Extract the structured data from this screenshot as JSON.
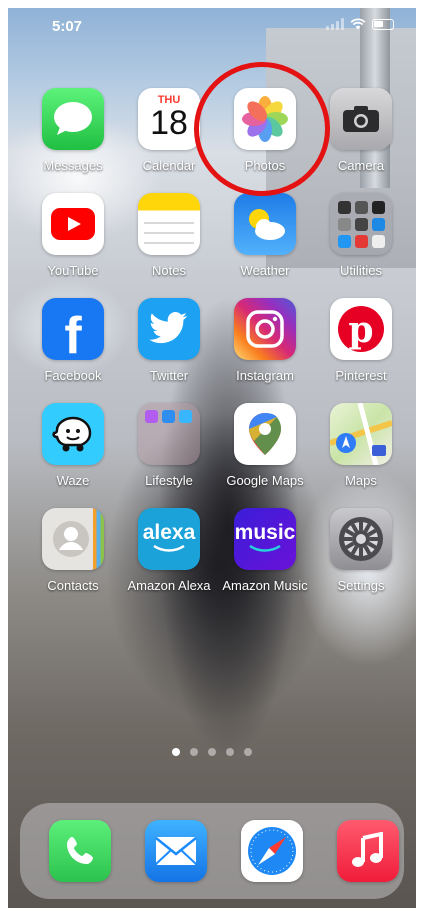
{
  "status_bar": {
    "time": "5:07"
  },
  "apps": [
    {
      "label": "Messages",
      "icon": "messages-icon",
      "color": "#2fd158"
    },
    {
      "label": "Calendar",
      "icon": "calendar-icon",
      "day": "THU",
      "date": "18"
    },
    {
      "label": "Photos",
      "icon": "photos-icon"
    },
    {
      "label": "Camera",
      "icon": "camera-icon",
      "color": "#3a3a3c"
    },
    {
      "label": "YouTube",
      "icon": "youtube-icon",
      "color": "#ff0000"
    },
    {
      "label": "Notes",
      "icon": "notes-icon",
      "color": "#ffd60a"
    },
    {
      "label": "Weather",
      "icon": "weather-icon",
      "color": "#2f8ef0"
    },
    {
      "label": "Utilities",
      "icon": "folder-icon"
    },
    {
      "label": "Facebook",
      "icon": "facebook-icon",
      "color": "#1877f2"
    },
    {
      "label": "Twitter",
      "icon": "twitter-icon",
      "color": "#1da1f2"
    },
    {
      "label": "Instagram",
      "icon": "instagram-icon"
    },
    {
      "label": "Pinterest",
      "icon": "pinterest-icon",
      "color": "#e60023"
    },
    {
      "label": "Waze",
      "icon": "waze-icon",
      "color": "#33ccff"
    },
    {
      "label": "Lifestyle",
      "icon": "folder-icon"
    },
    {
      "label": "Google Maps",
      "icon": "google-maps-icon"
    },
    {
      "label": "Maps",
      "icon": "maps-icon"
    },
    {
      "label": "Contacts",
      "icon": "contacts-icon"
    },
    {
      "label": "Amazon Alexa",
      "icon": "alexa-icon",
      "text": "alexa",
      "color": "#1aa2d9"
    },
    {
      "label": "Amazon Music",
      "icon": "amazon-music-icon",
      "text": "music",
      "color": "#4400ff"
    },
    {
      "label": "Settings",
      "icon": "settings-gear-icon"
    }
  ],
  "page_dots": {
    "count": 5,
    "active": 0
  },
  "dock": [
    {
      "icon": "phone-icon",
      "color": "#34c759"
    },
    {
      "icon": "mail-icon",
      "color": "#1a8cff"
    },
    {
      "icon": "safari-icon"
    },
    {
      "icon": "music-icon",
      "color": "#fa2d48"
    }
  ],
  "highlight_color": "#e41212"
}
